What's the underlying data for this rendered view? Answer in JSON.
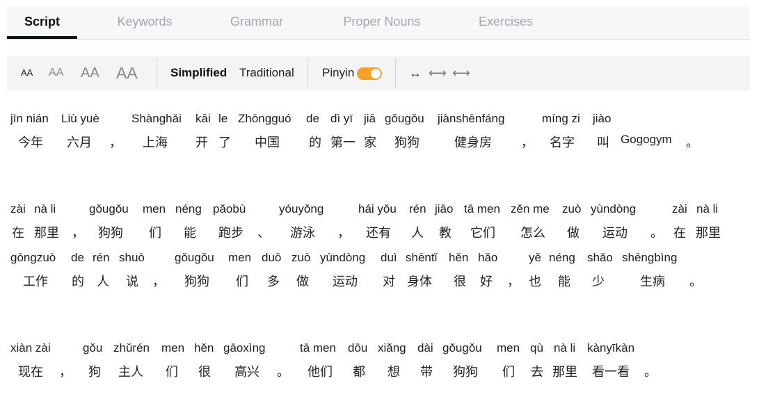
{
  "tabs": [
    {
      "label": "Script",
      "active": true
    },
    {
      "label": "Keywords",
      "active": false
    },
    {
      "label": "Grammar",
      "active": false
    },
    {
      "label": "Proper Nouns",
      "active": false
    },
    {
      "label": "Exercises",
      "active": false
    }
  ],
  "toolbar": {
    "font_sizes": [
      "AA",
      "AA",
      "AA",
      "AA"
    ],
    "selected_font_size": 0,
    "simplified_label": "Simplified",
    "traditional_label": "Traditional",
    "pinyin_label": "Pinyin",
    "pinyin_on": true,
    "accent_color": "#f5a02a",
    "spacing_icons": [
      "↔",
      "⟷",
      "⟷"
    ]
  },
  "lines": [
    [
      {
        "p": "jīn nián",
        "h": "今年"
      },
      {
        "p": "Liù yuè",
        "h": "六月"
      },
      {
        "p": "",
        "h": "，"
      },
      {
        "p": "Shànghǎi",
        "h": "上海"
      },
      {
        "p": "kāi",
        "h": "开"
      },
      {
        "p": "le",
        "h": "了"
      },
      {
        "p": "Zhōngguó",
        "h": "中国"
      },
      {
        "p": "de",
        "h": "的"
      },
      {
        "p": "dì yī",
        "h": "第一"
      },
      {
        "p": "jiā",
        "h": "家"
      },
      {
        "p": "gǒugǒu",
        "h": "狗狗"
      },
      {
        "p": "jiànshēnfáng",
        "h": "健身房"
      },
      {
        "p": "",
        "h": "，"
      },
      {
        "p": "míng zi",
        "h": "名字"
      },
      {
        "p": "jiào",
        "h": "叫"
      },
      {
        "p": "",
        "h": "Gogogym"
      },
      {
        "p": "",
        "h": "。"
      }
    ],
    [
      {
        "p": "zài",
        "h": "在"
      },
      {
        "p": "nà li",
        "h": "那里"
      },
      {
        "p": "",
        "h": "，"
      },
      {
        "p": "gǒugǒu",
        "h": "狗狗"
      },
      {
        "p": "men",
        "h": "们"
      },
      {
        "p": "néng",
        "h": "能"
      },
      {
        "p": "pǎobù",
        "h": "跑步"
      },
      {
        "p": "",
        "h": "、"
      },
      {
        "p": "yóuyǒng",
        "h": "游泳"
      },
      {
        "p": "",
        "h": "，"
      },
      {
        "p": "hái yǒu",
        "h": "还有"
      },
      {
        "p": "rén",
        "h": "人"
      },
      {
        "p": "jiāo",
        "h": "教"
      },
      {
        "p": "tā men",
        "h": "它们"
      },
      {
        "p": "zěn me",
        "h": "怎么"
      },
      {
        "p": "zuò",
        "h": "做"
      },
      {
        "p": "yùndòng",
        "h": "运动"
      },
      {
        "p": "",
        "h": "。"
      },
      {
        "p": "zài",
        "h": "在"
      },
      {
        "p": "nà li",
        "h": "那里"
      }
    ],
    [
      {
        "p": "gōngzuò",
        "h": "工作"
      },
      {
        "p": "de",
        "h": "的"
      },
      {
        "p": "rén",
        "h": "人"
      },
      {
        "p": "shuō",
        "h": "说"
      },
      {
        "p": "",
        "h": "，"
      },
      {
        "p": "gǒugǒu",
        "h": "狗狗"
      },
      {
        "p": "men",
        "h": "们"
      },
      {
        "p": "duō",
        "h": "多"
      },
      {
        "p": "zuò",
        "h": "做"
      },
      {
        "p": "yùndòng",
        "h": "运动"
      },
      {
        "p": "duì",
        "h": "对"
      },
      {
        "p": "shēntǐ",
        "h": "身体"
      },
      {
        "p": "hěn",
        "h": "很"
      },
      {
        "p": "hǎo",
        "h": "好"
      },
      {
        "p": "",
        "h": "，"
      },
      {
        "p": "yě",
        "h": "也"
      },
      {
        "p": "néng",
        "h": "能"
      },
      {
        "p": "shǎo",
        "h": "少"
      },
      {
        "p": "shēngbìng",
        "h": "生病"
      },
      {
        "p": "",
        "h": "。"
      }
    ],
    [
      {
        "p": "xiàn zài",
        "h": "现在"
      },
      {
        "p": "",
        "h": "，"
      },
      {
        "p": "gǒu",
        "h": "狗"
      },
      {
        "p": "zhǔrén",
        "h": "主人"
      },
      {
        "p": "men",
        "h": "们"
      },
      {
        "p": "hěn",
        "h": "很"
      },
      {
        "p": "gāoxìng",
        "h": "高兴"
      },
      {
        "p": "",
        "h": "。"
      },
      {
        "p": "tā men",
        "h": "他们"
      },
      {
        "p": "dōu",
        "h": "都"
      },
      {
        "p": "xiǎng",
        "h": "想"
      },
      {
        "p": "dài",
        "h": "带"
      },
      {
        "p": "gǒugǒu",
        "h": "狗狗"
      },
      {
        "p": "men",
        "h": "们"
      },
      {
        "p": "qù",
        "h": "去"
      },
      {
        "p": "nà li",
        "h": "那里"
      },
      {
        "p": "kànyīkàn",
        "h": "看一看"
      },
      {
        "p": "",
        "h": "。"
      }
    ]
  ]
}
